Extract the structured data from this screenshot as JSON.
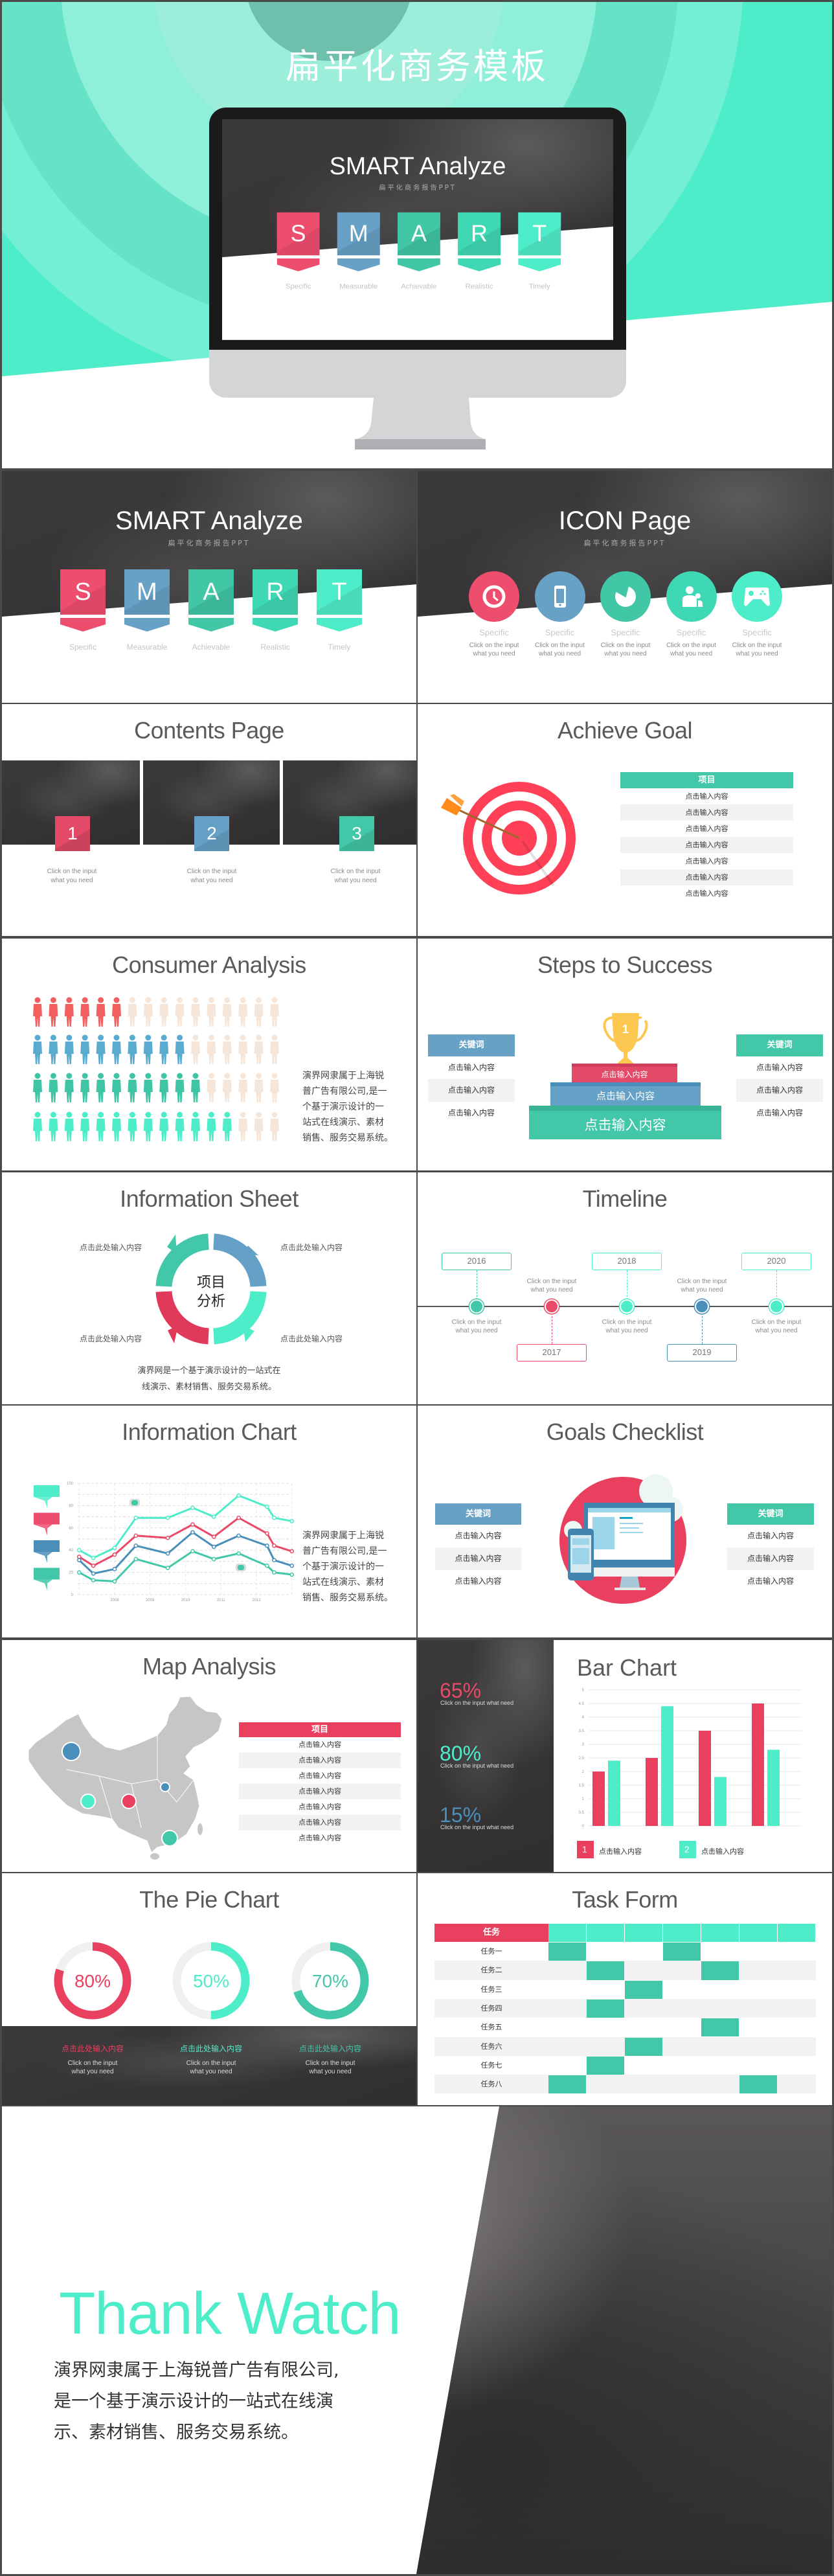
{
  "hero": {
    "title": "扁平化商务模板"
  },
  "smart": {
    "title": "SMART Analyze",
    "subtitle": "扁平化商务报告PPT",
    "items": [
      {
        "letter": "S",
        "label": "Specific",
        "color": "#ee4e6e"
      },
      {
        "letter": "M",
        "label": "Measurable",
        "color": "#67a1c6"
      },
      {
        "letter": "A",
        "label": "Achievable",
        "color": "#41c6a6"
      },
      {
        "letter": "R",
        "label": "Realistic",
        "color": "#3fd8b4"
      },
      {
        "letter": "T",
        "label": "Timely",
        "color": "#4eedc9"
      }
    ]
  },
  "icon_page": {
    "title": "ICON Page",
    "subtitle": "扁平化商务报告PPT",
    "items": [
      {
        "icon": "clock-icon",
        "label": "Specific",
        "line1": "Click on the input",
        "line2": "what you need",
        "color": "#ee4e6e"
      },
      {
        "icon": "smartphone-icon",
        "label": "Specific",
        "line1": "Click on the input",
        "line2": "what you need",
        "color": "#67a1c6"
      },
      {
        "icon": "pie-chart-icon",
        "label": "Specific",
        "line1": "Click on the input",
        "line2": "what you need",
        "color": "#41c6a6"
      },
      {
        "icon": "users-icon",
        "label": "Specific",
        "line1": "Click on the input",
        "line2": "what you need",
        "color": "#3fd8b4"
      },
      {
        "icon": "gamepad-icon",
        "label": "Specific",
        "line1": "Click on the input",
        "line2": "what you need",
        "color": "#4eedc9"
      }
    ]
  },
  "contents": {
    "title": "Contents Page",
    "items": [
      {
        "number": "1",
        "line1": "Click on the input",
        "line2": "what you need",
        "color": "#e24a68"
      },
      {
        "number": "2",
        "line1": "Click on the input",
        "line2": "what you need",
        "color": "#65a1c6"
      },
      {
        "number": "3",
        "line1": "Click on the input",
        "line2": "what you need",
        "color": "#42c8a8"
      }
    ]
  },
  "achieve_goal": {
    "title": "Achieve Goal",
    "header": "项目",
    "rows": [
      "点击输入内容",
      "点击输入内容",
      "点击输入内容",
      "点击输入内容",
      "点击输入内容",
      "点击输入内容",
      "点击输入内容"
    ]
  },
  "consumer": {
    "title": "Consumer Analysis",
    "per_row": 16,
    "empty_color": "#f5e6d9",
    "rows": [
      {
        "filled": 6,
        "color": "#f25f5f"
      },
      {
        "filled": 10,
        "color": "#5aabd0"
      },
      {
        "filled": 11,
        "color": "#3fc4a4"
      },
      {
        "filled": 13,
        "color": "#4eedc9"
      }
    ],
    "text_lines": [
      "演界网隶属于上海锐",
      "普广告有限公司,是一",
      "个基于演示设计的一",
      "站式在线演示、素材",
      "销售、服务交易系统。"
    ]
  },
  "steps": {
    "title": "Steps to Success",
    "left": {
      "header": "关键词",
      "rows": [
        "点击输入内容",
        "点击输入内容",
        "点击输入内容"
      ],
      "color": "#67a1c6"
    },
    "right": {
      "header": "关键词",
      "rows": [
        "点击输入内容",
        "点击输入内容",
        "点击输入内容"
      ],
      "color": "#42c8a8"
    },
    "podium": [
      "点击输入内容",
      "点击输入内容",
      "点击输入内容"
    ],
    "trophy_number": "1"
  },
  "info_sheet": {
    "title": "Information Sheet",
    "center": [
      "项目",
      "分析"
    ],
    "labels": [
      "点击此处输入内容",
      "点击此处输入内容",
      "点击此处输入内容",
      "点击此处输入内容"
    ],
    "text_lines": [
      "演界网是一个基于演示设计的一站式在",
      "线演示、素材销售、服务交易系统。"
    ]
  },
  "timeline": {
    "title": "Timeline",
    "events": [
      {
        "year": "2016",
        "position": "top",
        "line1": "Click on the input",
        "line2": "what you need",
        "color": "#42c8a8"
      },
      {
        "year": "2017",
        "position": "bottom",
        "line1": "Click on the input",
        "line2": "what you need",
        "color": "#e94a67"
      },
      {
        "year": "2018",
        "position": "top",
        "line1": "Click on the input",
        "line2": "what you need",
        "color": "#4eedc9"
      },
      {
        "year": "2019",
        "position": "bottom",
        "line1": "Click on the input",
        "line2": "what you need",
        "color": "#4a8fba"
      },
      {
        "year": "2020",
        "position": "top",
        "line1": "Click on the input",
        "line2": "what you need",
        "color": "#4eedc9"
      }
    ]
  },
  "info_chart": {
    "title": "Information Chart",
    "flag_colors": [
      "#4eedc9",
      "#ee4e6e",
      "#4a8fba",
      "#42c8a8"
    ],
    "text_lines": [
      "演界网隶属于上海锐",
      "普广告有限公司,是一",
      "个基于演示设计的一",
      "站式在线演示、素材",
      "销售、服务交易系统。"
    ]
  },
  "goals": {
    "title": "Goals Checklist",
    "left": {
      "header": "关键词",
      "rows": [
        "点击输入内容",
        "点击输入内容",
        "点击输入内容"
      ],
      "color": "#67a1c6"
    },
    "right": {
      "header": "关键词",
      "rows": [
        "点击输入内容",
        "点击输入内容",
        "点击输入内容"
      ],
      "color": "#42c8a8"
    }
  },
  "map": {
    "title": "Map Analysis",
    "header": "项目",
    "rows": [
      "点击输入内容",
      "点击输入内容",
      "点击输入内容",
      "点击输入内容",
      "点击输入内容",
      "点击输入内容",
      "点击输入内容"
    ]
  },
  "stats": [
    {
      "value": "65%",
      "caption": "Click on the input what need",
      "color": "#e94a67"
    },
    {
      "value": "80%",
      "caption": "Click on the input what need",
      "color": "#4eedc9"
    },
    {
      "value": "15%",
      "caption": "Click on the input what need",
      "color": "#4a8fba"
    }
  ],
  "bar": {
    "title": "Bar Chart",
    "legend": [
      {
        "number": "1",
        "label": "点击输入内容",
        "color": "#e94060"
      },
      {
        "number": "2",
        "label": "点击输入内容",
        "color": "#4eedc9"
      }
    ]
  },
  "pie": {
    "title": "The Pie Chart",
    "items": [
      {
        "heading": "点击此处输入内容",
        "line1": "Click on the input",
        "line2": "what you need"
      },
      {
        "heading": "点击此处输入内容",
        "line1": "Click on the input",
        "line2": "what you need"
      },
      {
        "heading": "点击此处输入内容",
        "line1": "Click on the input",
        "line2": "what you need"
      }
    ]
  },
  "task": {
    "title": "Task Form",
    "header": "任务",
    "columns": 7,
    "rows": [
      {
        "label": "任务一",
        "filled": [
          0,
          3
        ]
      },
      {
        "label": "任务二",
        "filled": [
          1,
          4
        ]
      },
      {
        "label": "任务三",
        "filled": [
          2
        ]
      },
      {
        "label": "任务四",
        "filled": [
          1
        ]
      },
      {
        "label": "任务五",
        "filled": [
          4
        ]
      },
      {
        "label": "任务六",
        "filled": [
          2
        ]
      },
      {
        "label": "任务七",
        "filled": [
          1
        ]
      },
      {
        "label": "任务八",
        "filled": [
          0,
          5
        ]
      }
    ],
    "colors": {
      "header_first": "#e94060",
      "header": "#4eedc9",
      "filled": "#42c8a8"
    }
  },
  "thanks": {
    "title": "Thank Watch",
    "lines": [
      "演界网隶属于上海锐普广告有限公司,",
      "是一个基于演示设计的一站式在线演",
      "示、素材销售、服务交易系统。"
    ]
  },
  "chart_data": [
    {
      "type": "line",
      "x": [
        2007.0,
        2007.4,
        2008.0,
        2008.6,
        2009.5,
        2010.2,
        2010.8,
        2011.5,
        2012.3,
        2012.5,
        2013.0
      ],
      "xticks": [
        "2008",
        "2009",
        "2010",
        "2011",
        "2012"
      ],
      "yticks": [
        "0",
        "20",
        "40",
        "60",
        "80",
        "100"
      ],
      "ylim": [
        0,
        100
      ],
      "grid": true,
      "series": [
        {
          "color": "#4eedc9",
          "values": [
            40,
            33,
            42,
            69,
            69,
            78,
            70,
            89,
            79,
            69,
            66
          ]
        },
        {
          "color": "#e94a67",
          "values": [
            34,
            26,
            36,
            53,
            51,
            63,
            52,
            69,
            55,
            44,
            39
          ]
        },
        {
          "color": "#4a8fba",
          "values": [
            31,
            19,
            23,
            44,
            37,
            56,
            43,
            53,
            44,
            31,
            26
          ]
        },
        {
          "color": "#42c8a8",
          "values": [
            20,
            13,
            12,
            32,
            24,
            39,
            32,
            37,
            26,
            20,
            18
          ]
        }
      ]
    },
    {
      "type": "bar",
      "categories": [
        "1",
        "2",
        "3",
        "4"
      ],
      "ylim": [
        0,
        5
      ],
      "yticks": [
        "0",
        "0.5",
        "1",
        "1.5",
        "2",
        "2.5",
        "3",
        "3.5",
        "4",
        "4.5",
        "5"
      ],
      "grid": true,
      "series": [
        {
          "color": "#e94060",
          "values": [
            2,
            2.5,
            3.5,
            4.5
          ]
        },
        {
          "color": "#4eedc9",
          "values": [
            2.4,
            4.4,
            1.8,
            2.8
          ]
        }
      ]
    },
    {
      "type": "pie",
      "values": [
        80,
        50,
        70
      ],
      "labels": [
        "80%",
        "50%",
        "70%"
      ],
      "colors": [
        "#e94060",
        "#4eedc9",
        "#42c8a8"
      ],
      "track_color": "#f0f0f0"
    }
  ]
}
